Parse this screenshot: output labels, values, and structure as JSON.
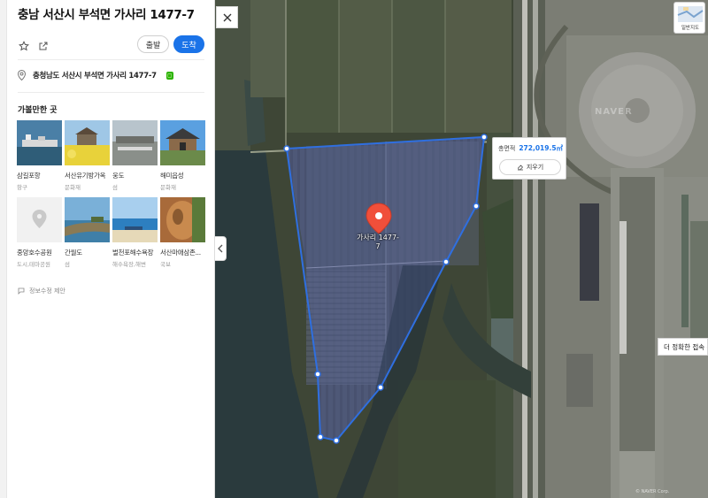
{
  "title": "충남 서산시 부석면 가사리 1477-7",
  "actions": {
    "depart_label": "출발",
    "arrive_label": "도착",
    "save_icon": "star-icon",
    "share_icon": "share-icon"
  },
  "address": {
    "text": "충청남도 서산시 부석면 가사리 1477-7",
    "icon": "location-pin-icon"
  },
  "nearby": {
    "section_title": "가볼만한 곳",
    "places": [
      {
        "name": "삼길포항",
        "category": "항구"
      },
      {
        "name": "서산유기방가옥",
        "category": "문화재"
      },
      {
        "name": "웅도",
        "category": "섬"
      },
      {
        "name": "해미읍성",
        "category": "문화재"
      },
      {
        "name": "중앙호수공원",
        "category": "도시,테마공원"
      },
      {
        "name": "간월도",
        "category": "섬"
      },
      {
        "name": "벌천포해수욕장",
        "category": "해수욕장,해변"
      },
      {
        "name": "서산마애삼존...",
        "category": "국보"
      }
    ]
  },
  "report_link": "정보수정 제안",
  "map": {
    "marker_label": "가사리 1477-7",
    "area_label": "총면적",
    "area_value": "272,019.5㎡",
    "clear_label": "지우기",
    "tooltip": "더 정확한 접속 위",
    "layer_label": "일반지도",
    "watermark": "NAVER",
    "copyright": "© NAVER Corp.",
    "colors": {
      "polygon_stroke": "#2f6fe0",
      "polygon_fill": "rgba(90,110,200,0.28)",
      "marker": "#f04f3a",
      "accent": "#1a73e8"
    }
  }
}
